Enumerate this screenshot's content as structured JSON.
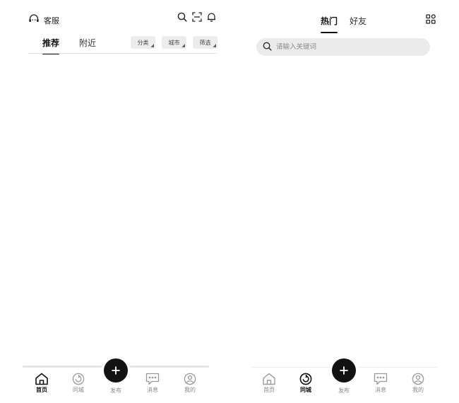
{
  "left": {
    "service_label": "客服",
    "tabs": [
      {
        "label": "推荐",
        "active": true
      },
      {
        "label": "附近",
        "active": false
      }
    ],
    "filters": [
      {
        "label": "分类"
      },
      {
        "label": "城市"
      },
      {
        "label": "筛选"
      }
    ],
    "icons": [
      "headset-icon",
      "search-icon",
      "scan-icon",
      "bell-icon"
    ],
    "bottom_nav": [
      {
        "label": "首页",
        "icon": "home-icon",
        "active": true
      },
      {
        "label": "同城",
        "icon": "local-icon",
        "active": false
      },
      {
        "label": "发布",
        "icon": "plus-icon",
        "active": false
      },
      {
        "label": "消息",
        "icon": "message-icon",
        "active": false
      },
      {
        "label": "我的",
        "icon": "profile-icon",
        "active": false
      }
    ]
  },
  "right": {
    "tabs": [
      {
        "label": "热门",
        "active": true
      },
      {
        "label": "好友",
        "active": false
      }
    ],
    "search_placeholder": "请输入关键词",
    "icons": [
      "apps-icon",
      "search-icon"
    ],
    "bottom_nav": [
      {
        "label": "首页",
        "icon": "home-icon",
        "active": false
      },
      {
        "label": "同城",
        "icon": "local-icon",
        "active": true
      },
      {
        "label": "发布",
        "icon": "plus-icon",
        "active": false
      },
      {
        "label": "消息",
        "icon": "message-icon",
        "active": false
      },
      {
        "label": "我的",
        "icon": "profile-icon",
        "active": false
      }
    ]
  },
  "colors": {
    "accent": "#121212",
    "inactive_text": "#888888",
    "chip_bg": "#ececec",
    "search_bg": "#ebebeb"
  }
}
